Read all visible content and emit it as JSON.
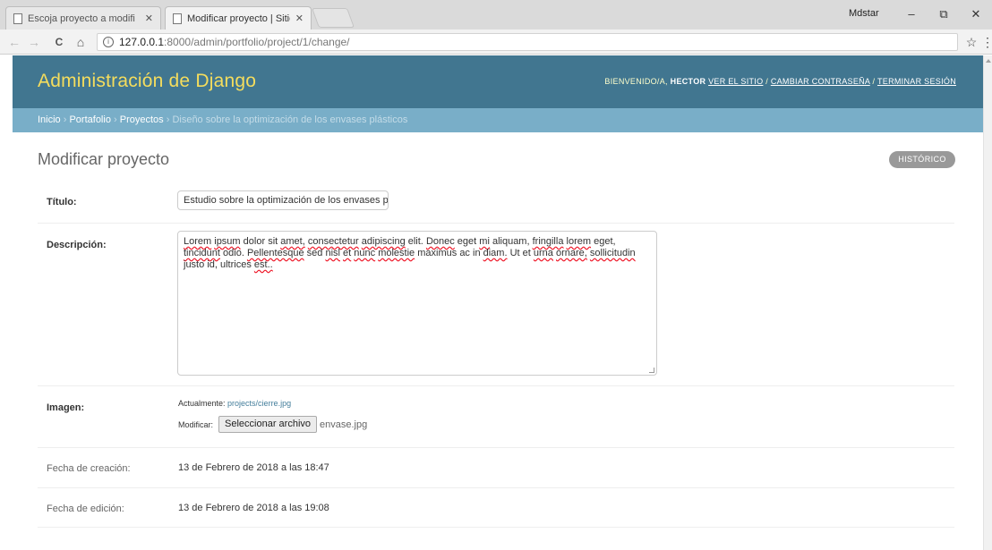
{
  "browser": {
    "tabs": [
      {
        "label": "Escoja proyecto a modifi"
      },
      {
        "label": "Modificar proyecto | Sitio"
      }
    ],
    "user": "Mdstar",
    "buttons": {
      "minimize": "–",
      "maximize": "⧉",
      "close": "✕"
    },
    "nav": {
      "back": "←",
      "forward": "→",
      "reload": "C",
      "home": "⌂",
      "star": "☆",
      "menu": "⋮"
    },
    "url": {
      "host": "127.0.0.1",
      "path": ":8000/admin/portfolio/project/1/change/"
    }
  },
  "header": {
    "branding": "Administración de Django",
    "welcome": "Bienvenido/a,",
    "username": "HECTOR",
    "links": [
      "Ver el sitio",
      "Cambiar contraseña",
      "Terminar sesión"
    ],
    "separator": " / "
  },
  "breadcrumbs": {
    "items": [
      "Inicio",
      "Portafolio",
      "Proyectos"
    ],
    "current": "Diseño sobre la optimización de los envases plásticos",
    "separator": " › "
  },
  "content": {
    "title": "Modificar proyecto",
    "history_button": "HISTÓRICO"
  },
  "form": {
    "title_label": "Título:",
    "title_value": "Estudio sobre la optimización de los envases plásticos",
    "description_label": "Descripción:",
    "description_words": [
      "Lorem",
      "ipsum",
      "dolor",
      "sit",
      "amet,",
      "consectetur",
      "adipiscing",
      "elit.",
      "Donec",
      "eget",
      "mi",
      "aliquam,",
      "fringilla",
      "lorem",
      "eget,",
      "tincidunt",
      "odio.",
      "Pellentesque",
      "sed",
      "nisl",
      "et",
      "nunc",
      "molestie",
      "maximus",
      "ac",
      "in",
      "diam.",
      "Ut",
      "et",
      "urna",
      "ornare,",
      "sollicitudin",
      "justo",
      "id,",
      "ultrices",
      "est.."
    ],
    "description_misspelled": [
      0,
      1,
      4,
      5,
      6,
      8,
      10,
      12,
      13,
      15,
      17,
      19,
      20,
      21,
      22,
      26,
      29,
      30,
      31,
      35
    ],
    "image_label": "Imagen:",
    "image_current_label": "Actualmente:",
    "image_current_value": "projects/cierre.jpg",
    "image_change_label": "Modificar:",
    "image_button": "Seleccionar archivo",
    "image_filename": "envase.jpg",
    "created_label": "Fecha de creación:",
    "created_value": "13 de Febrero de 2018 a las 18:47",
    "updated_label": "Fecha de edición:",
    "updated_value": "13 de Febrero de 2018 a las 19:08"
  }
}
